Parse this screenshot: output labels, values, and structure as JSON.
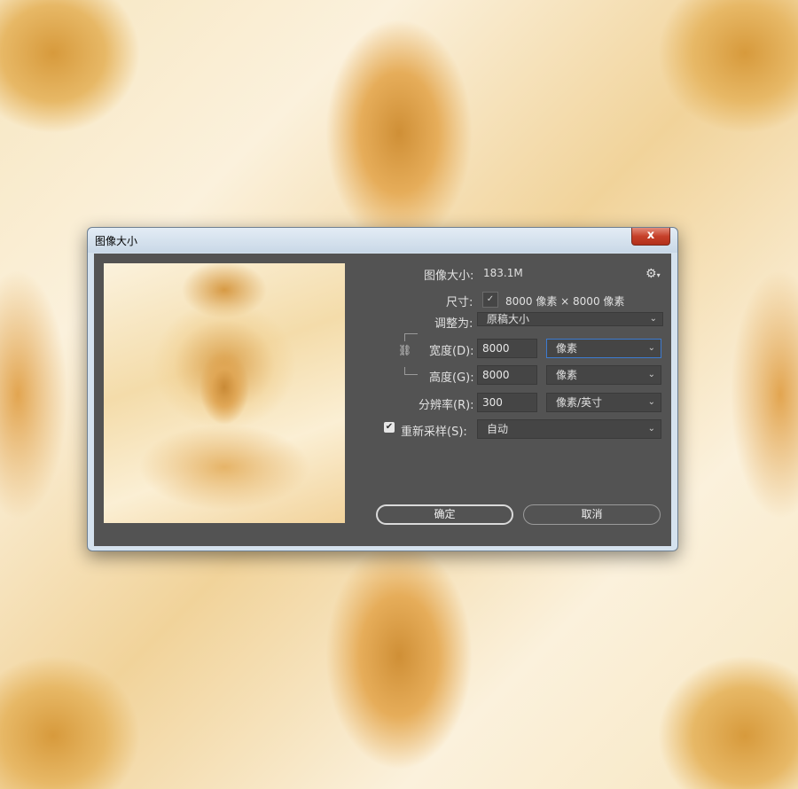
{
  "dialog": {
    "title": "图像大小",
    "close_label": "x"
  },
  "info": {
    "image_size_label": "图像大小:",
    "image_size_value": "183.1M",
    "dimensions_label": "尺寸:",
    "dimensions_value": "8000 像素 × 8000 像素",
    "fit_to_label": "调整为:",
    "fit_to_value": "原稿大小"
  },
  "fields": {
    "width_label": "宽度(D):",
    "width_value": "8000",
    "width_unit": "像素",
    "height_label": "高度(G):",
    "height_value": "8000",
    "height_unit": "像素",
    "resolution_label": "分辨率(R):",
    "resolution_value": "300",
    "resolution_unit": "像素/英寸",
    "resample_label": "重新采样(S):",
    "resample_value": "自动",
    "resample_checked": true
  },
  "buttons": {
    "ok": "确定",
    "cancel": "取消"
  },
  "icons": {
    "gear": "gear-icon",
    "chain": "link-icon",
    "chevron": "chevron-down-icon",
    "check": "check-icon"
  },
  "colors": {
    "panel_bg": "#535353",
    "focus_border": "#3d7bd0",
    "close_red": "#c6402a"
  }
}
